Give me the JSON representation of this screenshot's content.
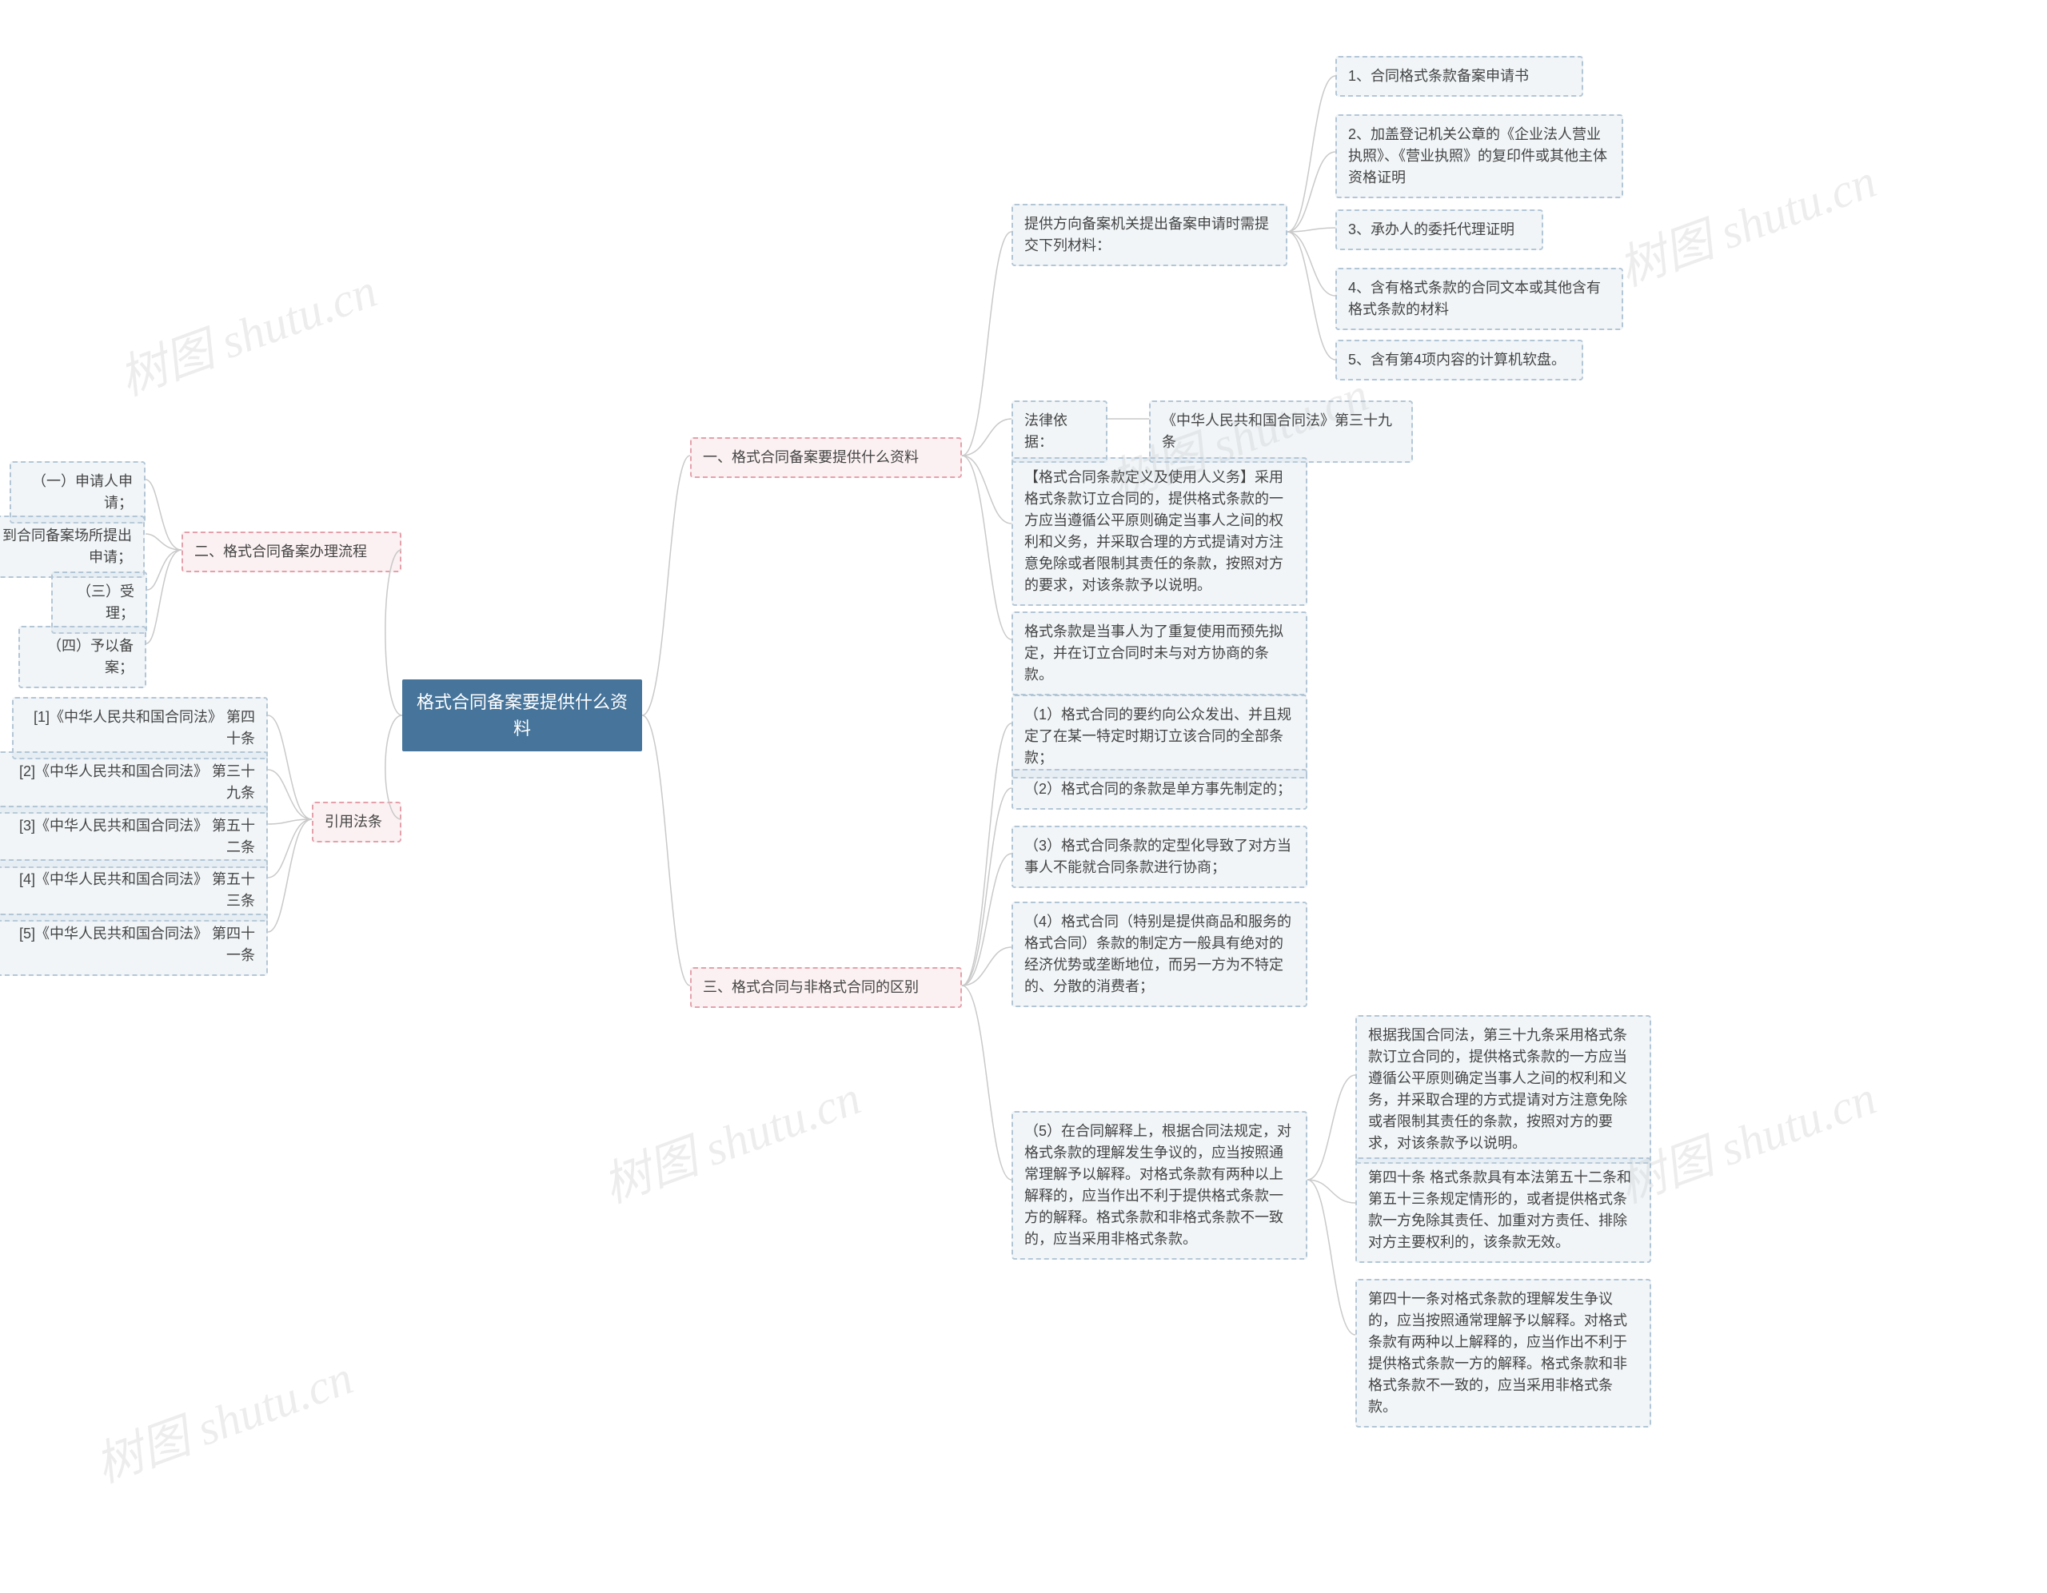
{
  "watermark": "树图 shutu.cn",
  "root": {
    "title": "格式合同备案要提供什么资料"
  },
  "branches": {
    "b1": {
      "label": "一、格式合同备案要提供什么资料"
    },
    "b2": {
      "label": "二、格式合同备案办理流程"
    },
    "b3": {
      "label": "三、格式合同与非格式合同的区别"
    },
    "b4": {
      "label": "引用法条"
    }
  },
  "b1": {
    "materials_intro": "提供方向备案机关提出备案申请时需提交下列材料：",
    "m1": "1、合同格式条款备案申请书",
    "m2": "2、加盖登记机关公章的《企业法人营业执照》、《营业执照》的复印件或其他主体资格证明",
    "m3": "3、承办人的委托代理证明",
    "m4": "4、含有格式条款的合同文本或其他含有格式条款的材料",
    "m5": "5、含有第4项内容的计算机软盘。",
    "legal_label": "法律依据：",
    "legal_ref": "《中华人民共和国合同法》第三十九条",
    "art39": "【格式合同条款定义及使用人义务】采用格式条款订立合同的，提供格式条款的一方应当遵循公平原则确定当事人之间的权利和义务，并采取合理的方式提请对方注意免除或者限制其责任的条款，按照对方的要求，对该条款予以说明。",
    "clause_def": "格式条款是当事人为了重复使用而预先拟定，并在订立合同时未与对方协商的条款。"
  },
  "b2": {
    "s1": "（一）申请人申请；",
    "s2": "（二）到合同备案场所提出申请；",
    "s3": "（三）受理；",
    "s4": "（四）予以备案；"
  },
  "b3": {
    "d1": "（1）格式合同的要约向公众发出、并且规定了在某一特定时期订立该合同的全部条款；",
    "d2": "（2）格式合同的条款是单方事先制定的；",
    "d3": "（3）格式合同条款的定型化导致了对方当事人不能就合同条款进行协商；",
    "d4": "（4）格式合同（特别是提供商品和服务的格式合同）条款的制定方一般具有绝对的经济优势或垄断地位，而另一方为不特定的、分散的消费者；",
    "d5": "（5）在合同解释上，根据合同法规定，对格式条款的理解发生争议的，应当按照通常理解予以解释。对格式条款有两种以上解释的，应当作出不利于提供格式条款一方的解释。格式条款和非格式条款不一致的，应当采用非格式条款。",
    "d5a": "根据我国合同法，第三十九条采用格式条款订立合同的，提供格式条款的一方应当遵循公平原则确定当事人之间的权利和义务，并采取合理的方式提请对方注意免除或者限制其责任的条款，按照对方的要求，对该条款予以说明。",
    "d5b": "第四十条 格式条款具有本法第五十二条和第五十三条规定情形的，或者提供格式条款一方免除其责任、加重对方责任、排除对方主要权利的，该条款无效。",
    "d5c": "第四十一条对格式条款的理解发生争议的，应当按照通常理解予以解释。对格式条款有两种以上解释的，应当作出不利于提供格式条款一方的解释。格式条款和非格式条款不一致的，应当采用非格式条款。"
  },
  "b4": {
    "r1": "[1]《中华人民共和国合同法》 第四十条",
    "r2": "[2]《中华人民共和国合同法》 第三十九条",
    "r3": "[3]《中华人民共和国合同法》 第五十二条",
    "r4": "[4]《中华人民共和国合同法》 第五十三条",
    "r5": "[5]《中华人民共和国合同法》 第四十一条"
  }
}
